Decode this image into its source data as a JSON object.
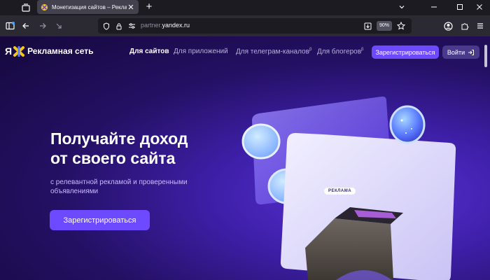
{
  "browser": {
    "tab_title": "Монетизация сайтов – Рекламная",
    "tab_close": "✕",
    "new_tab": "+",
    "url_prefix": "partner.",
    "url_host": "yandex.ru",
    "zoom": "90%"
  },
  "header": {
    "logo_ya": "Я",
    "logo_text": "Рекламная сеть",
    "nav": [
      {
        "label": "Для сайтов",
        "active": true
      },
      {
        "label": "Для приложений",
        "active": false
      },
      {
        "label": "Для телеграм-каналов",
        "sup": "β",
        "active": false
      },
      {
        "label": "Для блогеров",
        "sup": "β",
        "active": false
      }
    ],
    "register": "Зарегистрироваться",
    "login": "Войти"
  },
  "hero": {
    "title_line1": "Получайте доход",
    "title_line2": "от своего сайта",
    "subtitle_line1": "с релевантной рекламой и проверенными",
    "subtitle_line2": "объявлениями",
    "cta": "Зарегистрироваться",
    "ad_badge": "РЕКЛАМА"
  },
  "colors": {
    "accent": "#6d4aff",
    "page_bg": "#241063",
    "subtitle": "#c9b8ff"
  }
}
